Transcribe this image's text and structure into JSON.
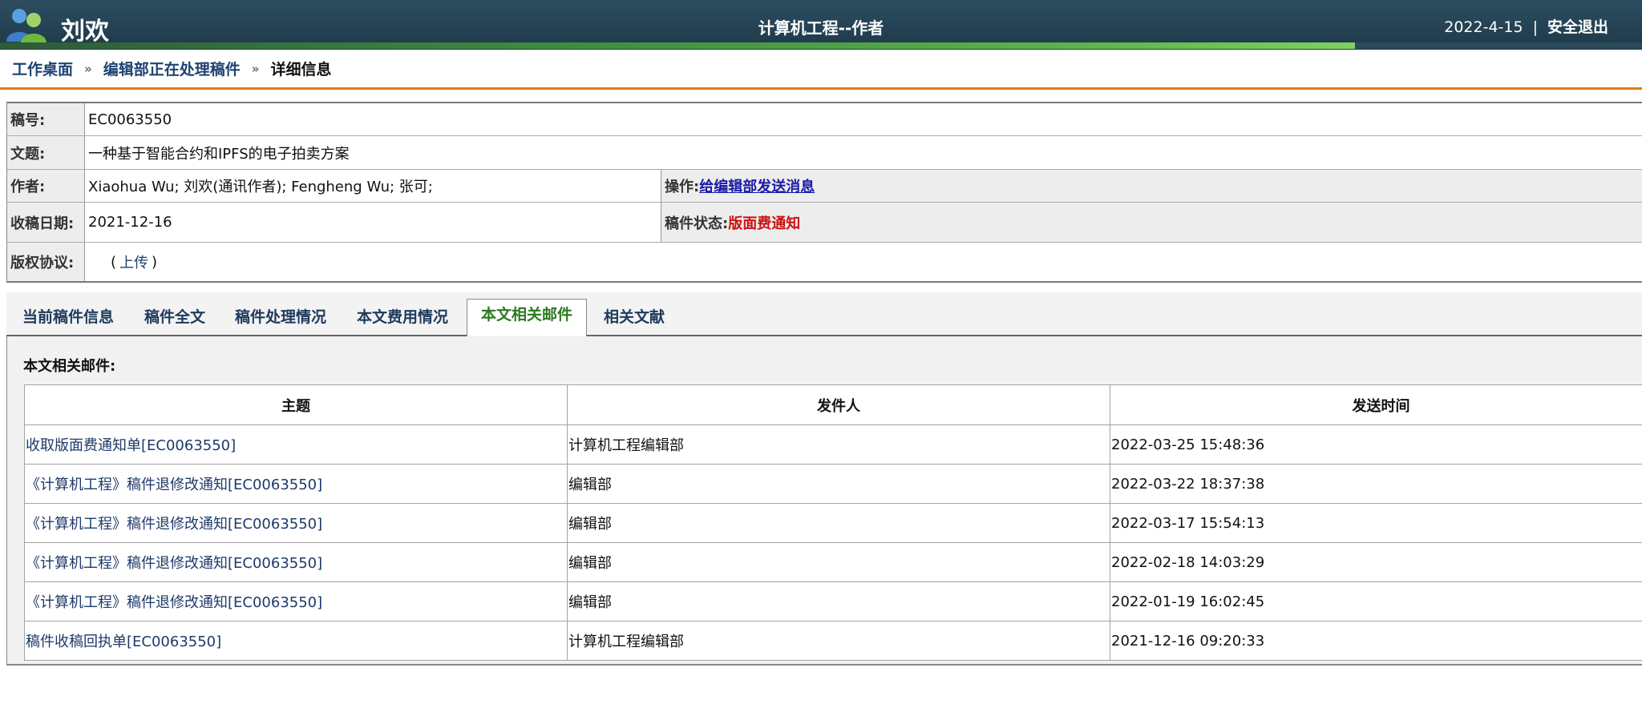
{
  "header": {
    "user_name": "刘欢",
    "app_title": "计算机工程--作者",
    "date": "2022-4-15",
    "separator": "|",
    "logout": "安全退出",
    "colors": {
      "header_bg": "#1e3a4b",
      "accent_orange": "#e07a18",
      "stripe_green": "#5fb34a"
    }
  },
  "breadcrumb": {
    "items": [
      "工作桌面",
      "编辑部正在处理稿件"
    ],
    "separator": "»",
    "current": "详细信息"
  },
  "info": {
    "manuscript_no": {
      "label": "稿号:",
      "value": "EC0063550"
    },
    "title": {
      "label": "文题:",
      "value": "一种基于智能合约和IPFS的电子拍卖方案"
    },
    "authors": {
      "label": "作者:",
      "value": "Xiaohua Wu; 刘欢(通讯作者); Fengheng Wu; 张可;"
    },
    "operation": {
      "label": "操作:",
      "link": "给编辑部发送消息"
    },
    "received_date": {
      "label": "收稿日期:",
      "value": "2021-12-16"
    },
    "status": {
      "label": "稿件状态:",
      "value": "版面费通知",
      "color": "#cc1111"
    },
    "copyright": {
      "label": "版权协议:",
      "open_paren": "(",
      "upload": "上传",
      "close_paren": ")"
    }
  },
  "tabs": [
    {
      "label": "当前稿件信息",
      "active": false
    },
    {
      "label": "稿件全文",
      "active": false
    },
    {
      "label": "稿件处理情况",
      "active": false
    },
    {
      "label": "本文费用情况",
      "active": false
    },
    {
      "label": "本文相关邮件",
      "active": true
    },
    {
      "label": "相关文献",
      "active": false
    }
  ],
  "mail": {
    "heading": "本文相关邮件:",
    "columns": [
      "主题",
      "发件人",
      "发送时间"
    ],
    "rows": [
      {
        "subject": "收取版面费通知单[EC0063550]",
        "sender": "计算机工程编辑部",
        "time": "2022-03-25 15:48:36"
      },
      {
        "subject": "《计算机工程》稿件退修改通知[EC0063550]",
        "sender": "编辑部",
        "time": "2022-03-22 18:37:38"
      },
      {
        "subject": "《计算机工程》稿件退修改通知[EC0063550]",
        "sender": "编辑部",
        "time": "2022-03-17 15:54:13"
      },
      {
        "subject": "《计算机工程》稿件退修改通知[EC0063550]",
        "sender": "编辑部",
        "time": "2022-02-18 14:03:29"
      },
      {
        "subject": "《计算机工程》稿件退修改通知[EC0063550]",
        "sender": "编辑部",
        "time": "2022-01-19 16:02:45"
      },
      {
        "subject": "稿件收稿回执单[EC0063550]",
        "sender": "计算机工程编辑部",
        "time": "2021-12-16 09:20:33"
      }
    ]
  }
}
